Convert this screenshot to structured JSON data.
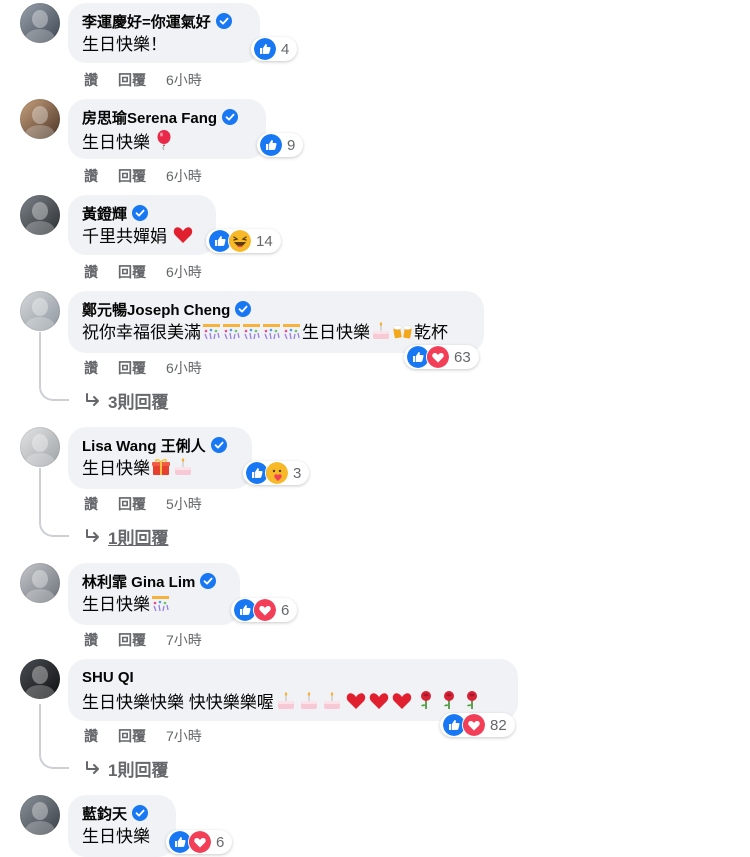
{
  "comments": [
    {
      "author": "李運慶好=你運氣好",
      "text": "生日快樂！",
      "reaction_count": "4",
      "like_label": "讚",
      "reply_label": "回覆",
      "time": "6小時"
    },
    {
      "author": "房思瑜Serena Fang",
      "text": "生日快樂",
      "reaction_count": "9",
      "like_label": "讚",
      "reply_label": "回覆",
      "time": "6小時"
    },
    {
      "author": "黃鐙輝",
      "text": "千里共嬋娟",
      "reaction_count": "14",
      "like_label": "讚",
      "reply_label": "回覆",
      "time": "6小時"
    },
    {
      "author": "鄭元暢Joseph Cheng",
      "text": "祝你幸福很美滿",
      "text_mid": "生日快樂",
      "text_end": "乾杯",
      "reaction_count": "63",
      "like_label": "讚",
      "reply_label": "回覆",
      "time": "6小時",
      "replies": "3則回覆"
    },
    {
      "author": "Lisa Wang 王俐人",
      "text": "生日快樂",
      "reaction_count": "3",
      "like_label": "讚",
      "reply_label": "回覆",
      "time": "5小時",
      "replies": "1則回覆"
    },
    {
      "author": "林利霏 Gina Lim",
      "text": "生日快樂",
      "reaction_count": "6",
      "like_label": "讚",
      "reply_label": "回覆",
      "time": "7小時"
    },
    {
      "author": "SHU QI",
      "text": "生日快樂快樂 快快樂樂喔",
      "reaction_count": "82",
      "like_label": "讚",
      "reply_label": "回覆",
      "time": "7小時",
      "replies": "1則回覆"
    },
    {
      "author": "藍鈞天",
      "text": "生日快樂",
      "reaction_count": "6"
    }
  ],
  "icons": {
    "verified": "verified-badge-icon",
    "like": "like-reaction-icon",
    "love": "love-reaction-icon",
    "haha": "haha-reaction-icon",
    "care": "care-reaction-icon",
    "reply_arrow": "reply-arrow-icon",
    "balloon": "balloon-emoji",
    "heart": "red-heart-emoji",
    "confetti": "confetti-emoji",
    "cake": "cake-emoji",
    "beers": "beers-emoji",
    "gift": "gift-emoji",
    "rose": "rose-emoji"
  },
  "colors": {
    "like_blue": "#1877f2",
    "love_red": "#f33e58",
    "bubble_bg": "#f0f2f5",
    "meta_gray": "#65676b"
  }
}
